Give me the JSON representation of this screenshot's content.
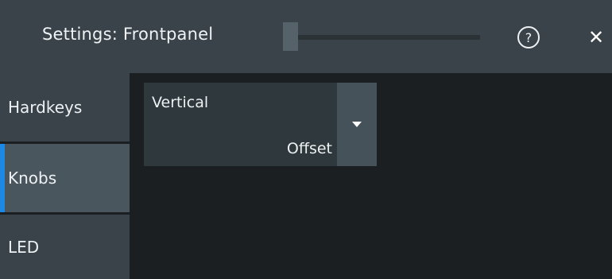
{
  "dialog": {
    "title": "Settings: Frontpanel",
    "help_icon": "?",
    "close_icon": "✕",
    "scroll_position": 0
  },
  "sidebar": {
    "items": [
      {
        "label": "Hardkeys",
        "active": false
      },
      {
        "label": "Knobs",
        "active": true
      },
      {
        "label": "LED",
        "active": false
      }
    ]
  },
  "knobs": {
    "combo": {
      "label": "Vertical",
      "value": "Offset",
      "icon": "chevron-down-icon"
    }
  },
  "colors": {
    "titlebar": "#394349",
    "background": "#1b1f22",
    "active_tab": "#4a565e",
    "accent": "#1e88e5"
  }
}
